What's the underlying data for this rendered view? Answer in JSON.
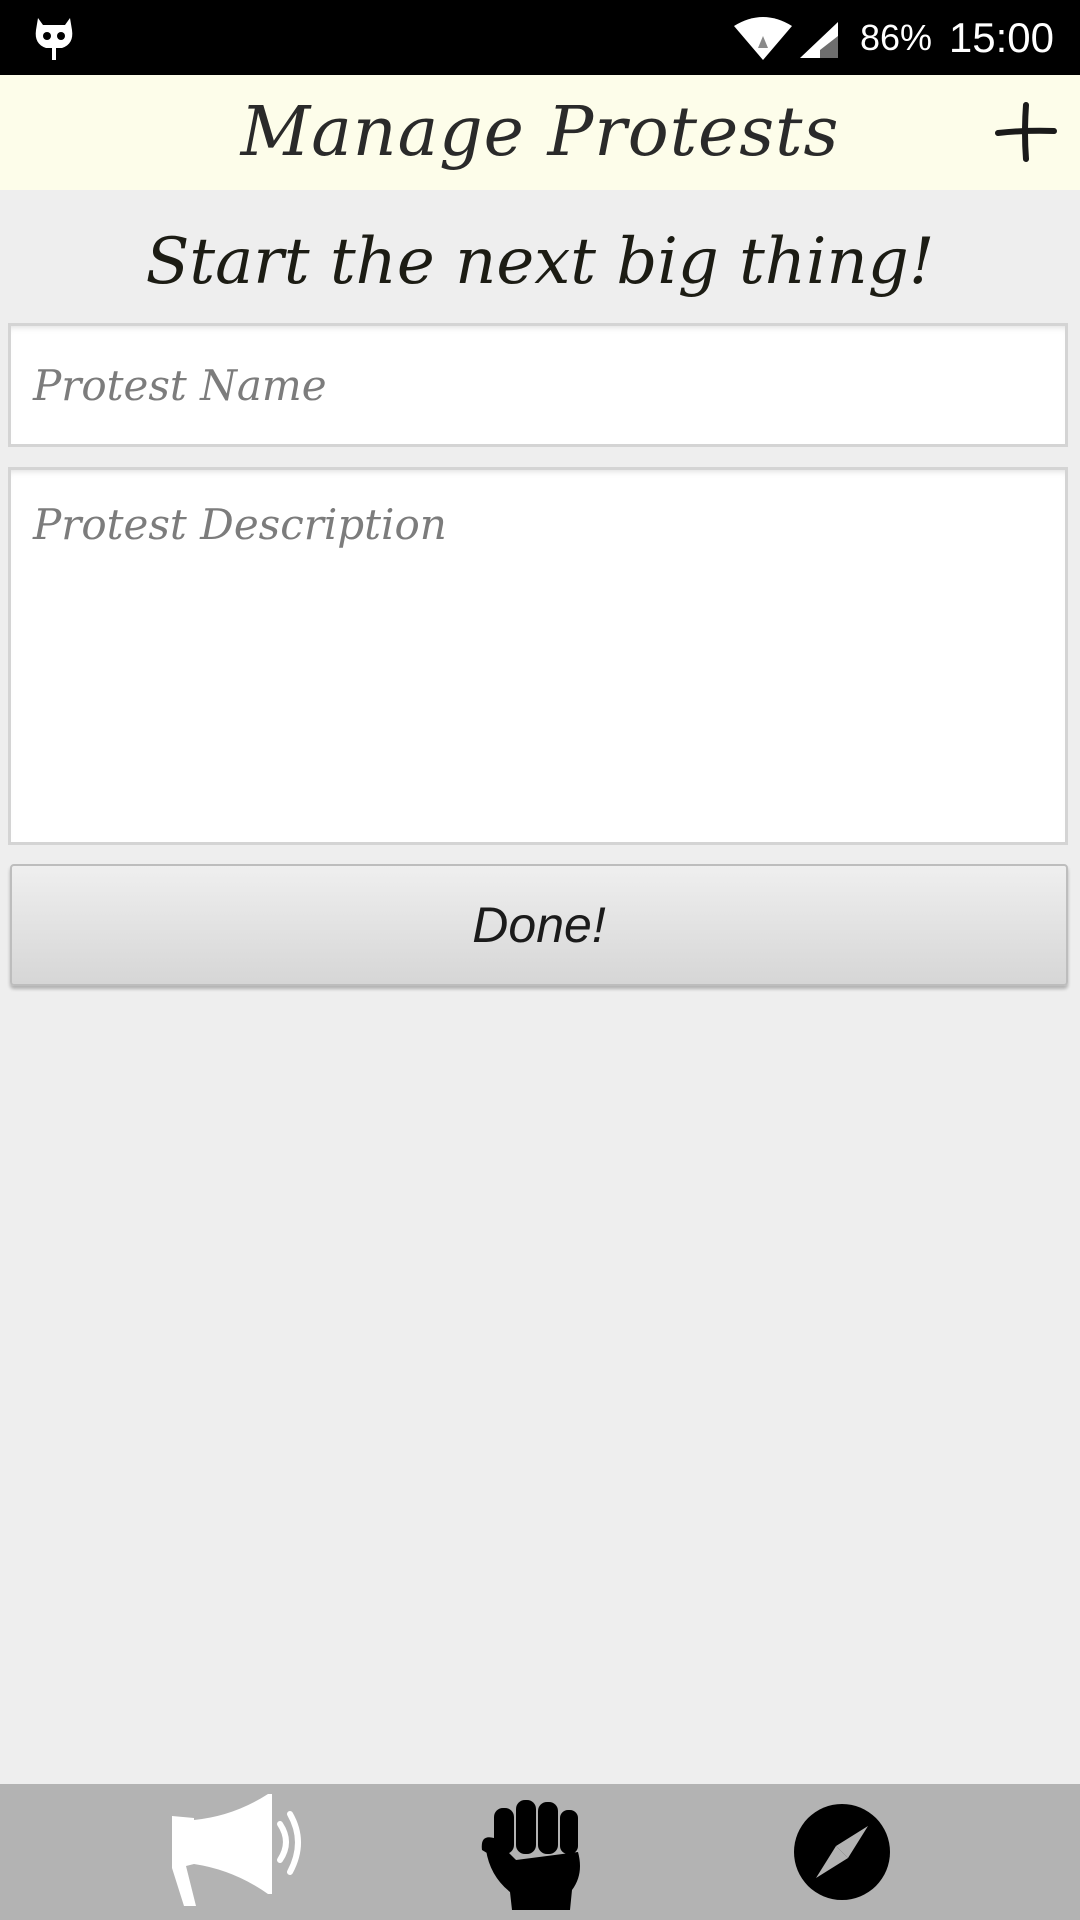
{
  "status_bar": {
    "battery": "86%",
    "time": "15:00",
    "icons": [
      "cyanogenmod-icon",
      "wifi-icon",
      "cell-signal-icon"
    ]
  },
  "header": {
    "title": "Manage Protests",
    "add_icon": "plus-icon"
  },
  "form": {
    "tagline": "Start the next big thing!",
    "name_placeholder": "Protest Name",
    "name_value": "",
    "description_placeholder": "Protest Description",
    "description_value": "",
    "done_label": "Done!"
  },
  "bottom_nav": {
    "items": [
      {
        "icon": "megaphone-icon"
      },
      {
        "icon": "raised-fist-icon"
      },
      {
        "icon": "compass-icon"
      }
    ]
  },
  "colors": {
    "status_bar": "#000000",
    "header_background": "#fdfdea",
    "page_background": "#eeeeee",
    "bottom_nav_background": "#b3b3b3"
  }
}
